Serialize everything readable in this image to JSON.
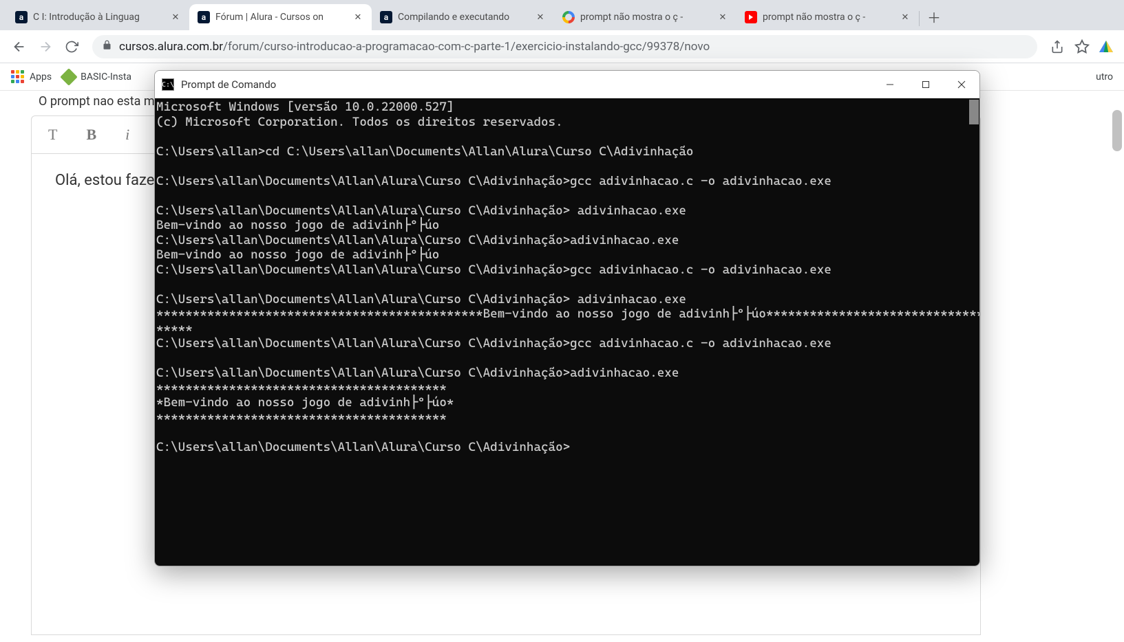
{
  "tabs": [
    {
      "title": "C I: Introdução à Linguag",
      "favicon": "alura"
    },
    {
      "title": "Fórum | Alura - Cursos on",
      "favicon": "alura",
      "active": true
    },
    {
      "title": "Compilando e executando",
      "favicon": "alura"
    },
    {
      "title": "prompt não mostra o ç -",
      "favicon": "google"
    },
    {
      "title": "prompt não mostra o ç -",
      "favicon": "youtube"
    }
  ],
  "toolbar": {
    "url_domain": "cursos.alura.com.br",
    "url_path": "/forum/curso-introducao-a-programacao-com-c-parte-1/exercicio-instalando-gcc/99378/novo"
  },
  "bookmarks": {
    "apps_label": "Apps",
    "item1": "BASIC-Insta",
    "other": "utro"
  },
  "page": {
    "partial_title": "O prompt nao esta m",
    "toolbar": {
      "t": "T",
      "b": "B",
      "i": "i"
    },
    "editor_text": "Olá, estou faze"
  },
  "cmd": {
    "title": "Prompt de Comando",
    "icon_text": "C:\\",
    "lines": [
      "Microsoft Windows [versão 10.0.22000.527]",
      "(c) Microsoft Corporation. Todos os direitos reservados.",
      "",
      "C:\\Users\\allan>cd C:\\Users\\allan\\Documents\\Allan\\Alura\\Curso C\\Adivinhação",
      "",
      "C:\\Users\\allan\\Documents\\Allan\\Alura\\Curso C\\Adivinhação>gcc adivinhacao.c -o adivinhacao.exe",
      "",
      "C:\\Users\\allan\\Documents\\Allan\\Alura\\Curso C\\Adivinhação> adivinhacao.exe",
      "Bem-vindo ao nosso jogo de adivinh├º├úo",
      "C:\\Users\\allan\\Documents\\Allan\\Alura\\Curso C\\Adivinhação>adivinhacao.exe",
      "Bem-vindo ao nosso jogo de adivinh├º├úo",
      "C:\\Users\\allan\\Documents\\Allan\\Alura\\Curso C\\Adivinhação>gcc adivinhacao.c -o adivinhacao.exe",
      "",
      "C:\\Users\\allan\\Documents\\Allan\\Alura\\Curso C\\Adivinhação> adivinhacao.exe",
      "*********************************************Bem-vindo ao nosso jogo de adivinh├º├úo*****************************************",
      "*****",
      "C:\\Users\\allan\\Documents\\Allan\\Alura\\Curso C\\Adivinhação>gcc adivinhacao.c -o adivinhacao.exe",
      "",
      "C:\\Users\\allan\\Documents\\Allan\\Alura\\Curso C\\Adivinhação>adivinhacao.exe",
      "****************************************",
      "*Bem-vindo ao nosso jogo de adivinh├º├úo*",
      "****************************************",
      "",
      "C:\\Users\\allan\\Documents\\Allan\\Alura\\Curso C\\Adivinhação>"
    ]
  }
}
